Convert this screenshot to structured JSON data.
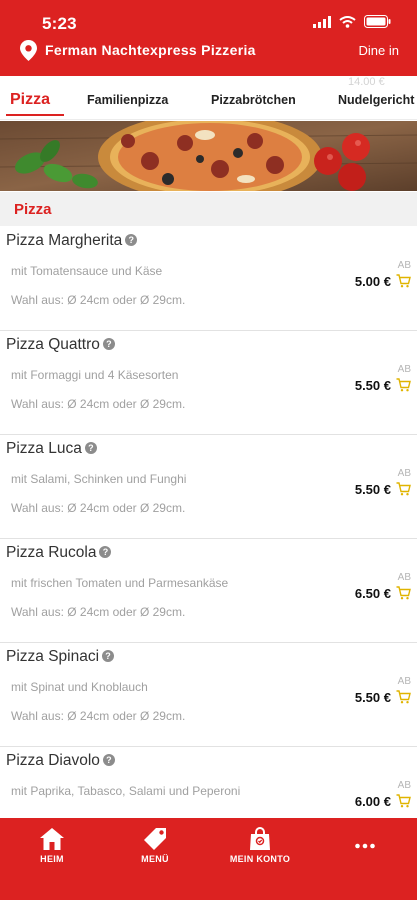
{
  "status_bar": {
    "time": "5:23"
  },
  "header": {
    "restaurant": "Ferman Nachtexpress Pizzeria",
    "mode": "Dine in"
  },
  "categories": {
    "ghost_price": "14.00 €",
    "tabs": [
      "Pizza",
      "Familienpizza",
      "Pizzabrötchen",
      "Nudelgericht"
    ],
    "active": "Pizza"
  },
  "section": {
    "title": "Pizza"
  },
  "items": [
    {
      "name": "Pizza Margherita",
      "desc": "mit Tomatensauce und Käse",
      "size": "Wahl aus: Ø 24cm oder Ø 29cm.",
      "ab": "AB",
      "price": "5.00 €"
    },
    {
      "name": "Pizza Quattro",
      "desc": "mit Formaggi und 4 Käsesorten",
      "size": "Wahl aus: Ø 24cm oder Ø 29cm.",
      "ab": "AB",
      "price": "5.50 €"
    },
    {
      "name": "Pizza Luca",
      "desc": "mit Salami, Schinken und Funghi",
      "size": "Wahl aus: Ø 24cm oder Ø 29cm.",
      "ab": "AB",
      "price": "5.50 €"
    },
    {
      "name": "Pizza Rucola",
      "desc": "mit frischen Tomaten und Parmesankäse",
      "size": "Wahl aus: Ø 24cm oder Ø 29cm.",
      "ab": "AB",
      "price": "6.50 €"
    },
    {
      "name": "Pizza Spinaci",
      "desc": "mit Spinat und Knoblauch",
      "size": "Wahl aus: Ø 24cm oder Ø 29cm.",
      "ab": "AB",
      "price": "5.50 €"
    },
    {
      "name": "Pizza Diavolo",
      "desc": "mit Paprika, Tabasco, Salami und Peperoni",
      "size": "",
      "ab": "AB",
      "price": "6.00 €"
    }
  ],
  "bottom_nav": [
    {
      "label": "HEIM",
      "icon": "home-icon"
    },
    {
      "label": "MENÜ",
      "icon": "tag-icon"
    },
    {
      "label": "MEIN KONTO",
      "icon": "bag-icon"
    },
    {
      "label": "",
      "icon": "more-icon"
    }
  ],
  "colors": {
    "brand_red": "#dc2221",
    "cart_gold": "#e0b400",
    "section_bg": "#f1f1f1"
  }
}
